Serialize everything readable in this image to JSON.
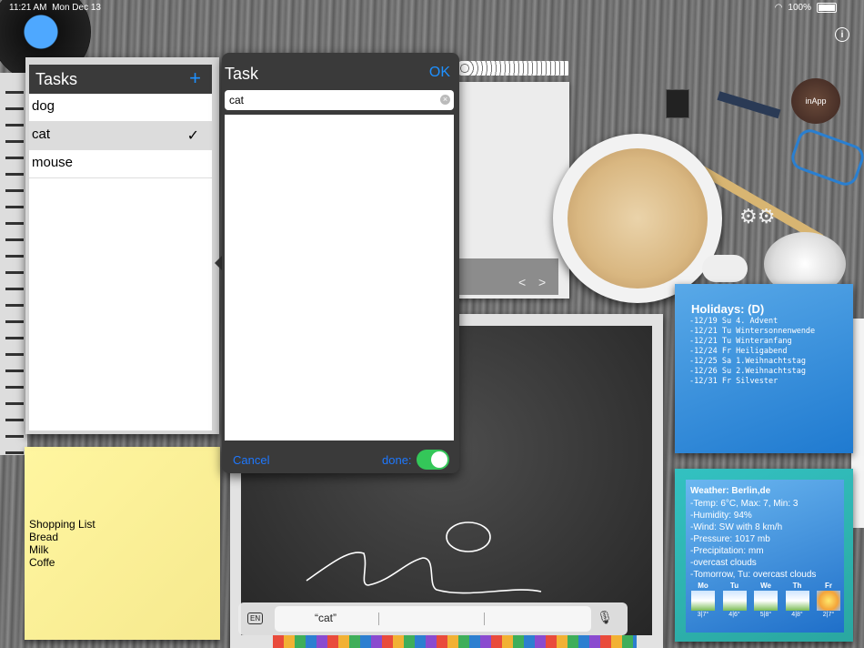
{
  "status_bar": {
    "time": "11:21 AM",
    "date": "Mon Dec 13",
    "battery": "100%"
  },
  "desk": {
    "inapp_label": "inApp",
    "info_icon": "info-icon"
  },
  "tasks_panel": {
    "title": "Tasks",
    "add_icon": "+",
    "items": [
      {
        "label": "dog",
        "selected": false
      },
      {
        "label": "cat",
        "selected": true
      },
      {
        "label": "mouse",
        "selected": false
      }
    ],
    "check_mark": "✓"
  },
  "task_popover": {
    "title": "Task",
    "ok_label": "OK",
    "field_value": "cat",
    "cancel_label": "Cancel",
    "done_label": "done:",
    "done_toggle_on": true
  },
  "holidays": {
    "title": "Holidays: (D)",
    "items": [
      "-12/19 Su 4. Advent",
      "-12/21 Tu Wintersonnenwende",
      "-12/21 Tu Winteranfang",
      "-12/24 Fr Heiligabend",
      "-12/25 Sa 1.Weihnachtstag",
      "-12/26 Su 2.Weihnachtstag",
      "-12/31 Fr Silvester"
    ]
  },
  "weather": {
    "title": "Weather: Berlin,de",
    "lines": [
      "-Temp: 6°C, Max: 7, Min: 3",
      "-Humidity: 94%",
      "-Wind: SW with 8 km/h",
      "-Pressure: 1017 mb",
      "-Precipitation: mm",
      "-overcast clouds",
      "-Tomorrow, Tu: overcast clouds"
    ],
    "forecast": [
      {
        "day": "Mo",
        "temp": "3|7°"
      },
      {
        "day": "Tu",
        "temp": "4|6°"
      },
      {
        "day": "We",
        "temp": "5|8°"
      },
      {
        "day": "Th",
        "temp": "4|8°"
      },
      {
        "day": "Fr",
        "temp": "2|7°"
      }
    ]
  },
  "sticky_note": {
    "lines": [
      "Shopping List",
      "Bread",
      "Milk",
      "Coffe"
    ]
  },
  "paper_nav": {
    "prev": "<",
    "next": ">"
  },
  "keyboard_bar": {
    "language": "EN",
    "suggestions": [
      "“cat”",
      "",
      ""
    ]
  },
  "colors": {
    "accent": "#1e90ff",
    "toggle_on": "#34c759",
    "panel_dark": "#3a3a3a"
  }
}
